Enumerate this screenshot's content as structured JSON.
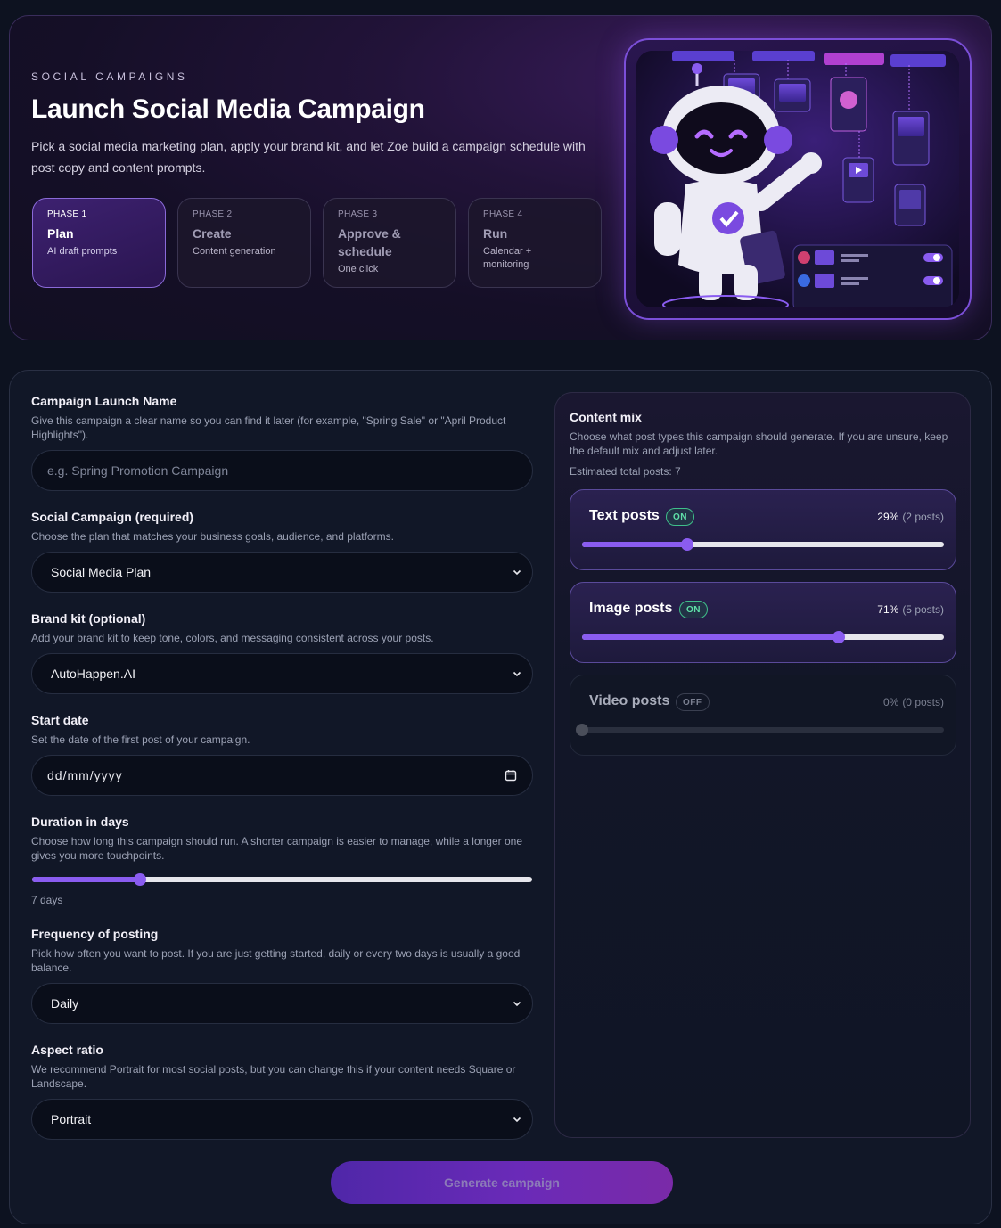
{
  "hero": {
    "eyebrow": "SOCIAL CAMPAIGNS",
    "title": "Launch Social Media Campaign",
    "description": "Pick a social media marketing plan, apply your brand kit, and let Zoe build a campaign schedule with post copy and content prompts.",
    "phases": [
      {
        "number": "PHASE 1",
        "name": "Plan",
        "sub": "AI draft prompts",
        "active": true
      },
      {
        "number": "PHASE 2",
        "name": "Create",
        "sub": "Content generation",
        "active": false
      },
      {
        "number": "PHASE 3",
        "name": "Approve & schedule",
        "sub": "One click",
        "active": false
      },
      {
        "number": "PHASE 4",
        "name": "Run",
        "sub": "Calendar + monitoring",
        "active": false
      }
    ]
  },
  "form": {
    "campaign_name": {
      "label": "Campaign Launch Name",
      "help": "Give this campaign a clear name so you can find it later (for example, \"Spring Sale\" or \"April Product Highlights\").",
      "placeholder": "e.g. Spring Promotion Campaign",
      "value": ""
    },
    "social_campaign": {
      "label": "Social Campaign (required)",
      "help": "Choose the plan that matches your business goals, audience, and platforms.",
      "value": "Social Media Plan"
    },
    "brand_kit": {
      "label": "Brand kit (optional)",
      "help": "Add your brand kit to keep tone, colors, and messaging consistent across your posts.",
      "value": "AutoHappen.AI"
    },
    "start_date": {
      "label": "Start date",
      "help": "Set the date of the first post of your campaign.",
      "value": "dd/mm/yyyy"
    },
    "duration": {
      "label": "Duration in days",
      "help": "Choose how long this campaign should run. A shorter campaign is easier to manage, while a longer one gives you more touchpoints.",
      "value_label": "7 days",
      "fill_fraction": 0.215
    },
    "frequency": {
      "label": "Frequency of posting",
      "help": "Pick how often you want to post. If you are just getting started, daily or every two days is usually a good balance.",
      "value": "Daily"
    },
    "aspect_ratio": {
      "label": "Aspect ratio",
      "help": "We recommend Portrait for most social posts, but you can change this if your content needs Square or Landscape.",
      "value": "Portrait"
    },
    "generate_label": "Generate campaign"
  },
  "content_mix": {
    "title": "Content mix",
    "help": "Choose what post types this campaign should generate. If you are unsure, keep the default mix and adjust later.",
    "estimate": "Estimated total posts: 7",
    "posts": [
      {
        "name": "Text posts",
        "badge": "ON",
        "percent": "29%",
        "count": "(2 posts)",
        "fraction": 0.29,
        "enabled": true
      },
      {
        "name": "Image posts",
        "badge": "ON",
        "percent": "71%",
        "count": "(5 posts)",
        "fraction": 0.71,
        "enabled": true
      },
      {
        "name": "Video posts",
        "badge": "OFF",
        "percent": "0%",
        "count": "(0 posts)",
        "fraction": 0.0,
        "enabled": false
      }
    ]
  },
  "colors": {
    "accent": "#8a5cf0",
    "on_badge": "#5fe0a8",
    "background": "#0d1220"
  }
}
